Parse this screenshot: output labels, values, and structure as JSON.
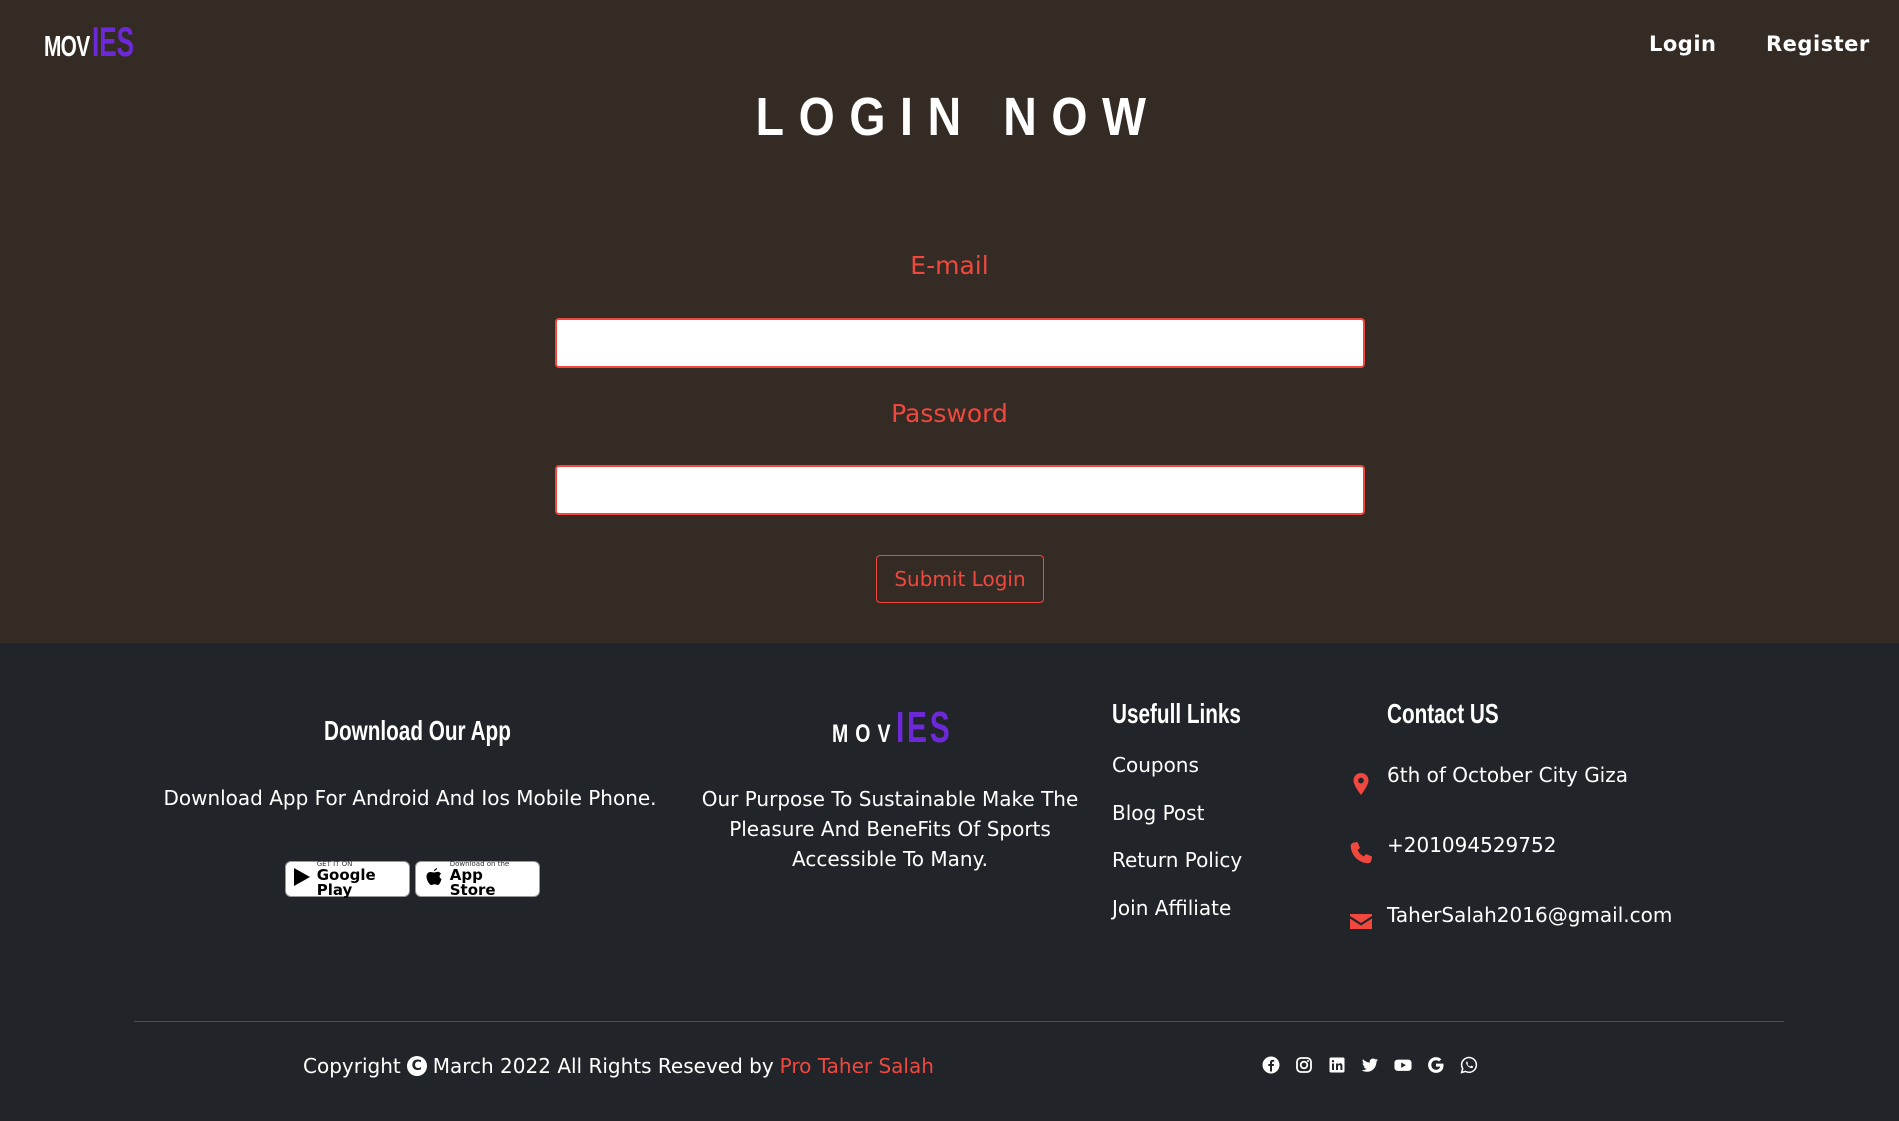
{
  "header": {
    "logo_part1": "MOV",
    "logo_part2": "IES",
    "nav": {
      "login": "Login",
      "register": "Register"
    }
  },
  "login": {
    "title": "LOGIN NOW",
    "email_label": "E-mail",
    "email_value": "",
    "password_label": "Password",
    "password_value": "",
    "submit_label": "Submit Login"
  },
  "footer": {
    "download": {
      "heading": "Download Our App",
      "text": "Download App For Android And Ios Mobile Phone.",
      "google_small": "GET IT ON",
      "google_big": "Google Play",
      "apple_small": "Download on the",
      "apple_big": "App Store"
    },
    "about": {
      "logo_part1": "MOV",
      "logo_part2": "IES",
      "text": "Our Purpose To Sustainable Make The Pleasure And BeneFits Of Sports Accessible To Many."
    },
    "links": {
      "heading": "Usefull Links",
      "items": [
        "Coupons",
        "Blog Post",
        "Return Policy",
        "Join Affiliate"
      ]
    },
    "contact": {
      "heading": "Contact US",
      "address": "6th of October City Giza",
      "phone": "+201094529752",
      "email": "TaherSalah2016@gmail.com"
    },
    "copyright": {
      "prefix": "Copyright",
      "symbol": "C",
      "text": "March 2022 All Rights Reseved by",
      "author": "Pro Taher Salah"
    },
    "socials": [
      "facebook-icon",
      "instagram-icon",
      "linkedin-icon",
      "twitter-icon",
      "youtube-icon",
      "google-icon",
      "whatsapp-icon"
    ]
  },
  "colors": {
    "hero_bg": "#352b25",
    "footer_bg": "#212429",
    "accent": "#f0483e",
    "logo_purple": "#6d28d9"
  }
}
